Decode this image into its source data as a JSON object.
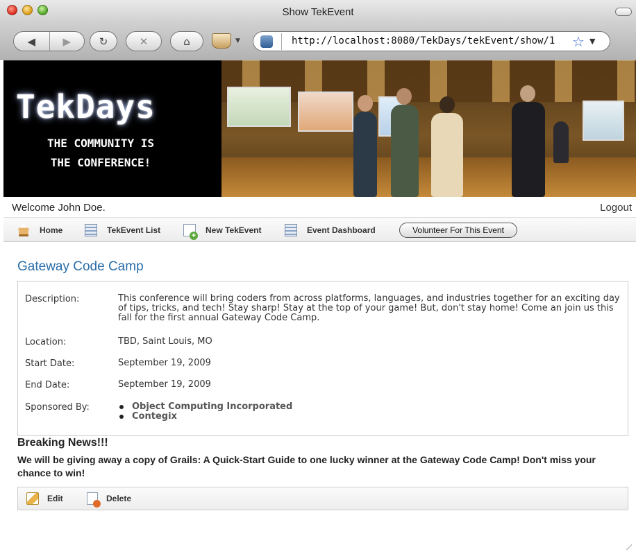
{
  "window": {
    "title": "Show TekEvent"
  },
  "browser": {
    "url": "http://localhost:8080/TekDays/tekEvent/show/1",
    "back_glyph": "◀",
    "forward_glyph": "▶",
    "reload_glyph": "↻",
    "stop_glyph": "✕",
    "home_glyph": "⌂",
    "bookmark_glyph": "☆",
    "dropdown_glyph": "▼"
  },
  "banner": {
    "logo": "TekDays",
    "tagline_line1": "THE COMMUNITY IS",
    "tagline_line2": "THE CONFERENCE!"
  },
  "user": {
    "welcome": "Welcome John Doe.",
    "logout": "Logout"
  },
  "nav": {
    "home": "Home",
    "tekevent_list": "TekEvent List",
    "new_tekevent": "New TekEvent",
    "event_dashboard": "Event Dashboard",
    "volunteer": "Volunteer For This Event"
  },
  "event": {
    "name": "Gateway Code Camp",
    "description_label": "Description:",
    "description": "This conference will bring coders from across platforms, languages, and industries together for an exciting day of tips, tricks, and tech! Stay sharp! Stay at the top of your game! But, don't stay home! Come an join us this fall for the first annual Gateway Code Camp.",
    "location_label": "Location:",
    "location": "TBD, Saint Louis, MO",
    "start_label": "Start Date:",
    "start_date": "September 19, 2009",
    "end_label": "End Date:",
    "end_date": "September 19, 2009",
    "sponsors_label": "Sponsored By:",
    "sponsors": [
      "Object Computing Incorporated",
      "Contegix"
    ]
  },
  "news": {
    "title": "Breaking News!!!",
    "text": "We will be giving away a copy of Grails: A Quick-Start Guide to one lucky winner at the Gateway Code Camp! Don't miss your chance to win!"
  },
  "actions": {
    "edit": "Edit",
    "delete": "Delete"
  }
}
